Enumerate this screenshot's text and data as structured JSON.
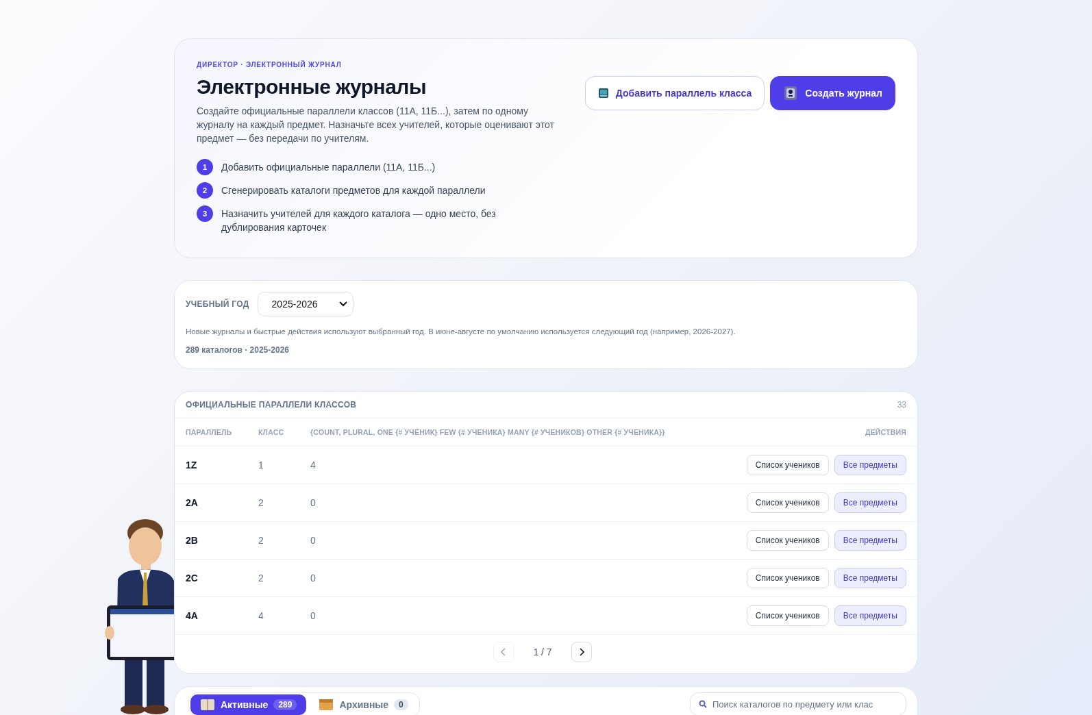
{
  "header": {
    "eyebrow": "ДИРЕКТОР · ЭЛЕКТРОННЫЙ ЖУРНАЛ",
    "title": "Электронные журналы",
    "description": "Создайте официальные параллели классов (11А, 11Б...), затем по одному журналу на каждый предмет. Назначьте всех учителей, которые оценивают этот предмет — без передачи по учителям.",
    "steps": [
      {
        "number": "1",
        "text": "Добавить официальные параллели (11А, 11Б...)"
      },
      {
        "number": "2",
        "text": "Сгенерировать каталоги предметов для каждой параллели"
      },
      {
        "number": "3",
        "text": "Назначить учителей для каждого каталога — одно место, без дублирования карточек"
      }
    ],
    "buttons": [
      {
        "label": "Добавить параллель класса",
        "kind": "secondary"
      },
      {
        "label": "Создать журнал",
        "kind": "primary"
      }
    ]
  },
  "school_year": {
    "label": "УЧЕБНЫЙ ГОД",
    "value": "2025-2026",
    "note": "Новые журналы и быстрые действия используют выбранный год. В июне-августе по умолчанию используется следующий год (например, 2026-2027).",
    "summary": "289 каталогов · 2025-2026"
  },
  "parallels": {
    "title": "ОФИЦИАЛЬНЫЕ ПАРАЛЛЕЛИ КЛАССОВ",
    "count": "33",
    "columns": [
      "ПАРАЛЛЕЛЬ",
      "КЛАСС",
      "{COUNT, PLURAL, ONE {# УЧЕНИК} FEW {# УЧЕНИКА} MANY {# УЧЕНИКОВ} OTHER {# УЧЕНИКА}}",
      "ДЕЙСТВИЯ"
    ],
    "rows": [
      {
        "parallel": "1Z",
        "grade": "1",
        "students": "4",
        "actions": [
          "Список учеников",
          "Все предметы"
        ]
      },
      {
        "parallel": "2A",
        "grade": "2",
        "students": "0",
        "actions": [
          "Список учеников",
          "Все предметы"
        ]
      },
      {
        "parallel": "2B",
        "grade": "2",
        "students": "0",
        "actions": [
          "Список учеников",
          "Все предметы"
        ]
      },
      {
        "parallel": "2C",
        "grade": "2",
        "students": "0",
        "actions": [
          "Список учеников",
          "Все предметы"
        ]
      },
      {
        "parallel": "4A",
        "grade": "4",
        "students": "0",
        "actions": [
          "Список учеников",
          "Все предметы"
        ]
      }
    ],
    "pagination": {
      "page": "1 / 7",
      "prev_disabled": true,
      "next_disabled": false
    }
  },
  "catalogs": {
    "tabs": [
      {
        "label": "Активные",
        "count": "289",
        "selected": true
      },
      {
        "label": "Архивные",
        "count": "0",
        "selected": false
      }
    ],
    "search": {
      "placeholder": "Поиск каталогов по предмету или клас"
    }
  }
}
